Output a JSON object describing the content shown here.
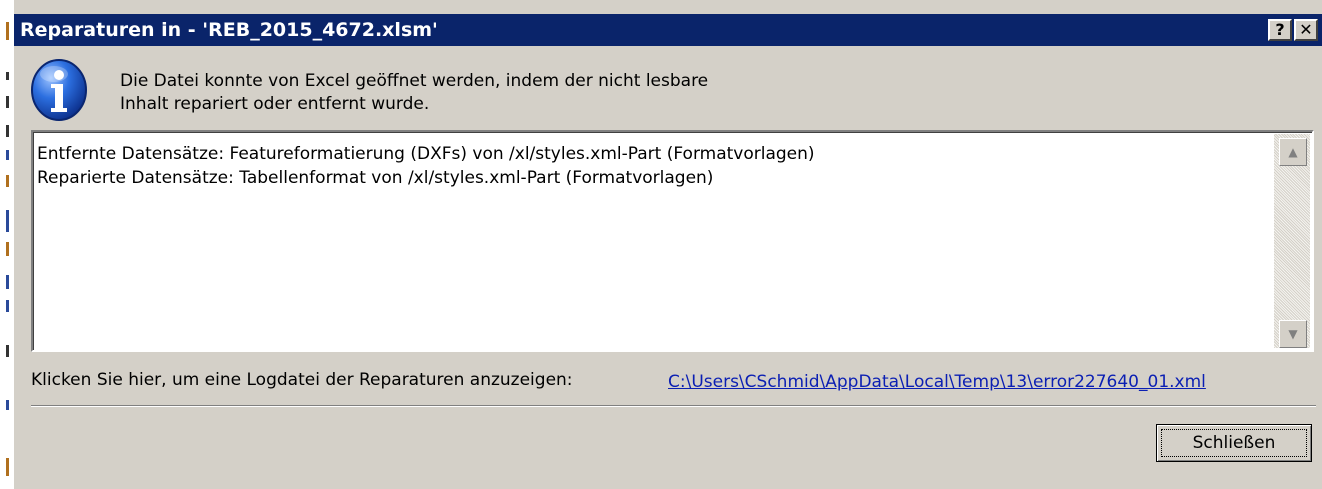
{
  "dialog": {
    "title": "Reparaturen in - 'REB_2015_4672.xlsm'",
    "help_label": "?",
    "close_label": "✕",
    "message_line1": "Die Datei konnte von Excel geöffnet werden, indem der nicht lesbare",
    "message_line2": "Inhalt repariert oder entfernt wurde.",
    "details": [
      "Entfernte Datensätze: Featureformatierung (DXFs) von /xl/styles.xml-Part (Formatvorlagen)",
      "Reparierte Datensätze: Tabellenformat von /xl/styles.xml-Part (Formatvorlagen)"
    ],
    "log_label": "Klicken Sie hier, um eine Logdatei der Reparaturen anzuzeigen:",
    "log_link": "C:\\Users\\CSchmid\\AppData\\Local\\Temp\\13\\error227640_01.xml",
    "close_button_label": "Schließen"
  },
  "icons": {
    "info": "info-icon",
    "scroll_up": "scroll-up-arrow-icon",
    "scroll_down": "scroll-down-arrow-icon"
  },
  "colors": {
    "titlebar": "#0a246a",
    "link": "#0b1fb3",
    "dialog_bg": "#d4d0c8"
  }
}
